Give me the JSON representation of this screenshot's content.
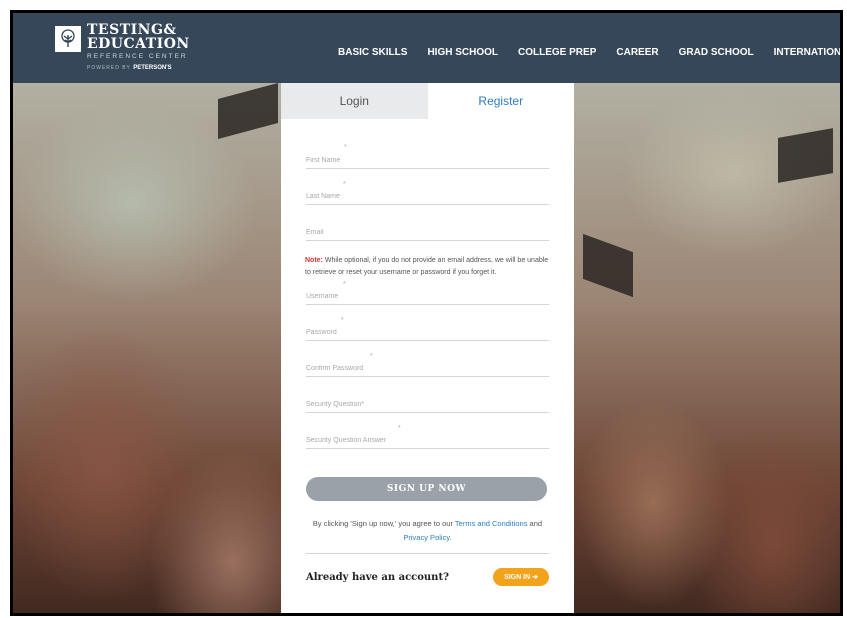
{
  "header": {
    "logo": {
      "line1": "TESTING&",
      "line2": "EDUCATION",
      "line3": "REFERENCE CENTER",
      "powered_by": "POWERED BY",
      "brand": "PETERSON'S"
    },
    "nav": [
      {
        "label": "BASIC SKILLS"
      },
      {
        "label": "HIGH SCHOOL"
      },
      {
        "label": "COLLEGE PREP"
      },
      {
        "label": "CAREER"
      },
      {
        "label": "GRAD SCHOOL"
      },
      {
        "label": "INTERNATIONAL"
      }
    ]
  },
  "tabs": {
    "login": "Login",
    "register": "Register"
  },
  "form": {
    "first_name_placeholder": "First Name",
    "last_name_placeholder": "Last Name",
    "email_placeholder": "Email",
    "required_mark": "*",
    "note_label": "Note:",
    "note_text": " While optional, if you do not provide an email address, we will be unable to retrieve or reset your username or password if you forget it.",
    "username_placeholder": "Username",
    "password_placeholder": "Password",
    "confirm_password_placeholder": "Confirm Password",
    "security_question_placeholder": "Security Question*",
    "security_answer_placeholder": "Security Question Answer",
    "signup_button": "SIGN UP NOW",
    "terms_prefix": "By clicking 'Sign up now,' you agree to our ",
    "terms_link": "Terms and Conditions",
    "terms_and": " and ",
    "privacy_link": "Privacy Policy",
    "terms_suffix": ".",
    "account_question": "Already have an account?",
    "signin_button": "SIGN IN ➔"
  },
  "colors": {
    "header_bg": "#36475a",
    "accent_blue": "#2f7dc1",
    "signup_gray": "#9aa1a9",
    "signin_orange": "#f2a21b",
    "note_red": "#d0342c"
  }
}
